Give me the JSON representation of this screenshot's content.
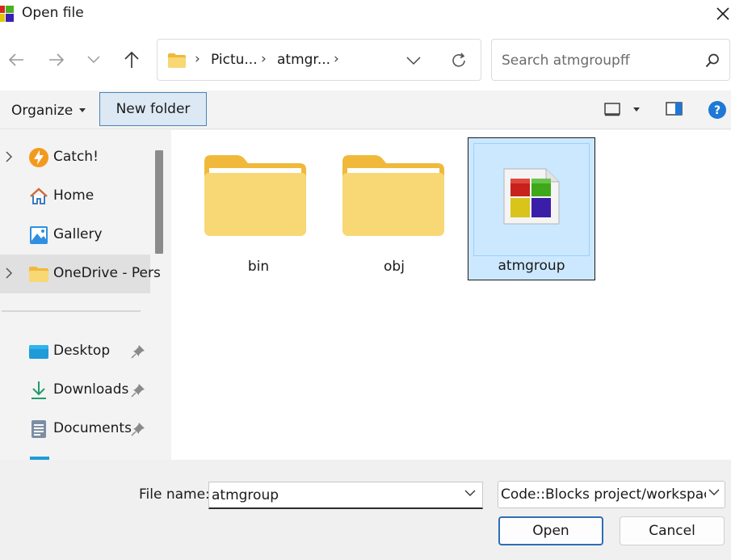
{
  "window": {
    "title": "Open file"
  },
  "address": {
    "segments": [
      "Pictu...",
      "atmgr..."
    ]
  },
  "search": {
    "placeholder": "Search atmgroupff"
  },
  "toolbar": {
    "organize_label": "Organize",
    "new_folder_label": "New folder"
  },
  "sidebar": {
    "items": [
      {
        "label": "Catch!",
        "icon": "lightning-icon",
        "expandable": true
      },
      {
        "label": "Home",
        "icon": "home-icon",
        "expandable": false
      },
      {
        "label": "Gallery",
        "icon": "gallery-icon",
        "expandable": false
      },
      {
        "label": "OneDrive - Pers",
        "icon": "folder-icon",
        "expandable": true,
        "selected": true
      },
      {
        "label": "Desktop",
        "icon": "desktop-icon",
        "pinned": true
      },
      {
        "label": "Downloads",
        "icon": "download-icon",
        "pinned": true
      },
      {
        "label": "Documents",
        "icon": "document-icon",
        "pinned": true
      }
    ]
  },
  "content": {
    "items": [
      {
        "name": "bin",
        "type": "folder"
      },
      {
        "name": "obj",
        "type": "folder"
      },
      {
        "name": "atmgroup",
        "type": "codeblocks-project",
        "selected": true
      }
    ]
  },
  "footer": {
    "file_name_label": "File name:",
    "file_name_value": "atmgroup",
    "file_type_value": "Code::Blocks project/workspace files",
    "open_label": "Open",
    "cancel_label": "Cancel"
  },
  "colors": {
    "accent": "#2f6eb5",
    "selection": "#cce8ff",
    "folder": "#f8d775"
  }
}
